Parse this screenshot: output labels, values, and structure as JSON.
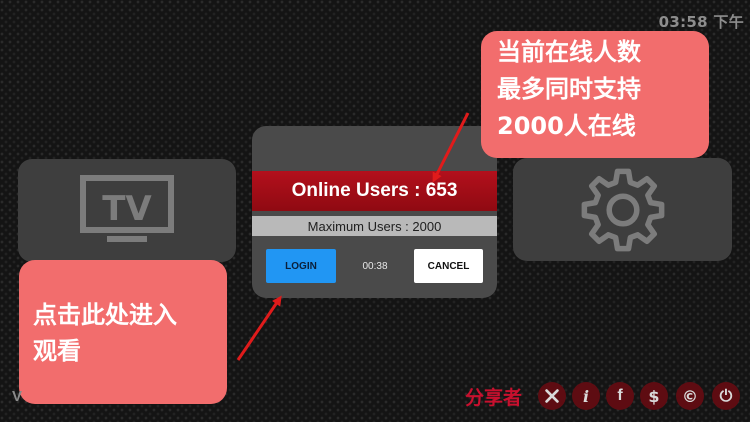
{
  "status_bar": {
    "time": "03:58 下午"
  },
  "dialog": {
    "online_users": "Online Users : 653",
    "maximum_users": "Maximum Users : 2000",
    "login_label": "LOGIN",
    "countdown": "00:38",
    "cancel_label": "CANCEL"
  },
  "annotations": {
    "top_lines": [
      "当前在线人数",
      "最多同时支持",
      "2000人在线"
    ],
    "bottom_lines": [
      "点击此处进入",
      "观看"
    ]
  },
  "footer": {
    "version": "V",
    "watermark": "分享者",
    "icons": [
      "tools-icon",
      "info-icon",
      "facebook-icon",
      "dollar-icon",
      "copyright-icon",
      "power-icon"
    ]
  },
  "colors": {
    "online_bar": "#a50f18",
    "login_button": "#2196f3",
    "callout": "#f26d6d",
    "arrow": "#e01b1b",
    "footer_icon_bg": "#5e0c12"
  }
}
